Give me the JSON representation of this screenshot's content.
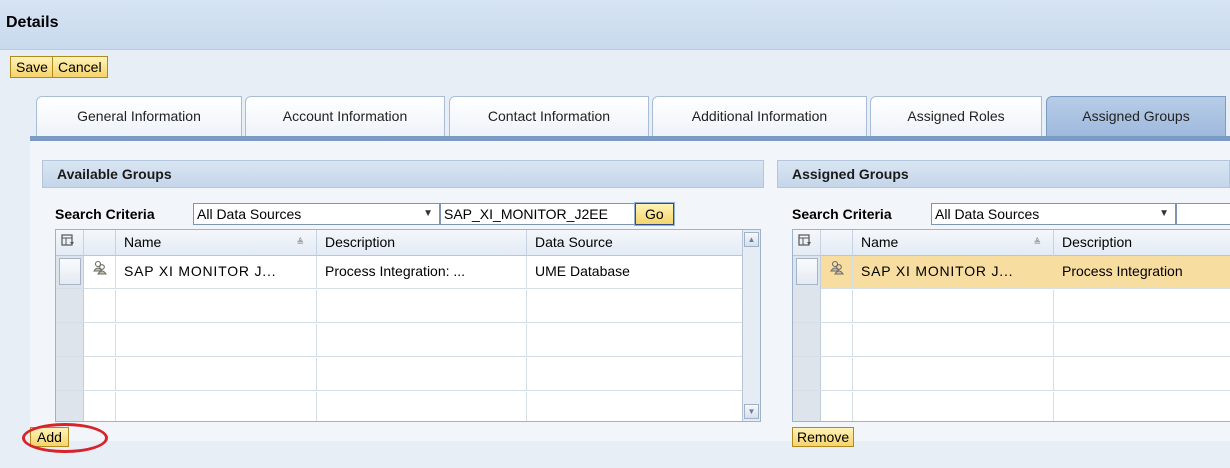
{
  "header": {
    "title": "Details"
  },
  "toolbar": {
    "save_label": "Save",
    "cancel_label": "Cancel"
  },
  "tabs": [
    {
      "label": "General Information"
    },
    {
      "label": "Account Information"
    },
    {
      "label": "Contact Information"
    },
    {
      "label": "Additional Information"
    },
    {
      "label": "Assigned Roles"
    },
    {
      "label": "Assigned Groups",
      "active": true
    }
  ],
  "available": {
    "title": "Available Groups",
    "search_label": "Search Criteria",
    "source_select": "All Data Sources",
    "search_value": "SAP_XI_MONITOR_J2EE",
    "go_label": "Go",
    "columns": [
      "Name",
      "Description",
      "Data Source"
    ],
    "rows": [
      {
        "name": "SAP XI MONITOR J...",
        "description": "Process Integration: ...",
        "source": "UME Database"
      }
    ],
    "add_label": "Add"
  },
  "assigned": {
    "title": "Assigned Groups",
    "search_label": "Search Criteria",
    "source_select": "All Data Sources",
    "search_value": "",
    "columns": [
      "Name",
      "Description"
    ],
    "rows": [
      {
        "name": "SAP XI MONITOR J...",
        "description": "Process Integration"
      }
    ],
    "remove_label": "Remove"
  },
  "icons": {
    "column_menu": "table-settings-icon",
    "group": "group-icon",
    "sort": "sort-icon",
    "dropdown": "chevron-down-icon",
    "scroll_up": "scroll-up-icon",
    "scroll_down": "scroll-down-icon"
  },
  "colors": {
    "header_bg": "#c9daee",
    "button_yellow": "#f5d46a",
    "selected_row": "#f7dda0",
    "annotation_ring": "#d8232a",
    "tab_active": "#9fbade"
  }
}
